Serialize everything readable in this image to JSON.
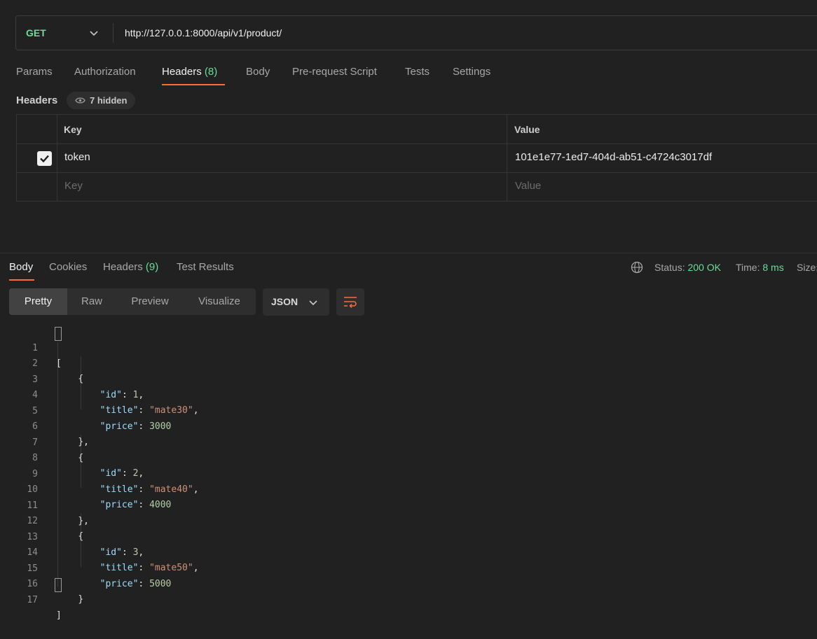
{
  "request": {
    "method": "GET",
    "url": "http://127.0.0.1:8000/api/v1/product/"
  },
  "request_tabs": {
    "params": "Params",
    "authorization": "Authorization",
    "headers": "Headers",
    "headers_count": "(8)",
    "body": "Body",
    "pre_request": "Pre-request Script",
    "tests": "Tests",
    "settings": "Settings"
  },
  "headers_section": {
    "label": "Headers",
    "hidden_pill": "7 hidden",
    "key_col": "Key",
    "value_col": "Value",
    "rows": [
      {
        "key": "token",
        "value": "101e1e77-1ed7-404d-ab51-c4724c3017df",
        "checked": true
      }
    ],
    "placeholder_key": "Key",
    "placeholder_value": "Value"
  },
  "response_tabs": {
    "body": "Body",
    "cookies": "Cookies",
    "headers": "Headers",
    "headers_count": "(9)",
    "test_results": "Test Results"
  },
  "status": {
    "status_label": "Status:",
    "status_value": "200 OK",
    "time_label": "Time:",
    "time_value": "8 ms",
    "size_label": "Size:"
  },
  "view": {
    "pretty": "Pretty",
    "raw": "Raw",
    "preview": "Preview",
    "visualize": "Visualize",
    "format": "JSON"
  },
  "colors": {
    "accent": "#ff6c37",
    "success": "#6bdd9a",
    "json_key": "#9cdcfe",
    "json_string": "#ce9178",
    "json_number": "#b5cea8"
  },
  "response_body": [
    {
      "id": "1",
      "title": "\"mate30\"",
      "price": "3000"
    },
    {
      "id": "2",
      "title": "\"mate40\"",
      "price": "4000"
    },
    {
      "id": "3",
      "title": "\"mate50\"",
      "price": "5000"
    }
  ],
  "json_tokens": {
    "open_array": "[",
    "close_array": "]",
    "open_obj": "{",
    "close_obj": "},",
    "close_obj_last": "}",
    "key_id": "\"id\"",
    "key_title": "\"title\"",
    "key_price": "\"price\""
  },
  "line_numbers": [
    "1",
    "2",
    "3",
    "4",
    "5",
    "6",
    "7",
    "8",
    "9",
    "10",
    "11",
    "12",
    "13",
    "14",
    "15",
    "16",
    "17"
  ]
}
